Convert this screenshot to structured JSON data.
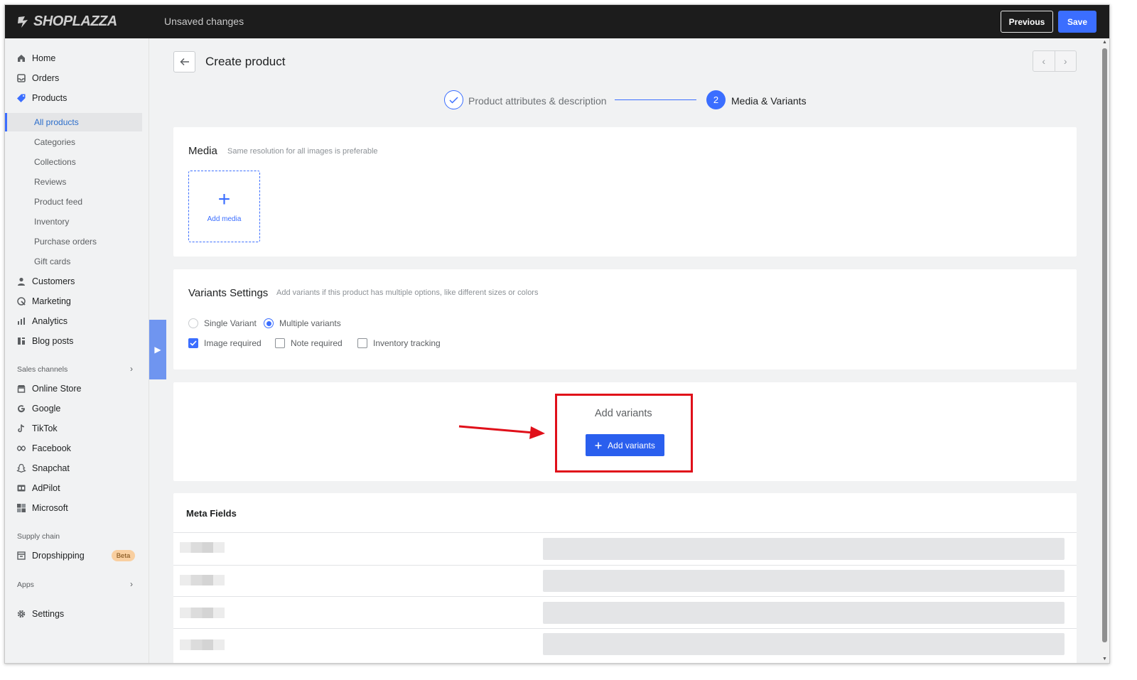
{
  "topbar": {
    "brand": "SHOPLAZZA",
    "status": "Unsaved changes",
    "previous_label": "Previous",
    "save_label": "Save"
  },
  "sidebar": {
    "items": [
      {
        "label": "Home",
        "icon": "home-icon"
      },
      {
        "label": "Orders",
        "icon": "orders-icon"
      },
      {
        "label": "Products",
        "icon": "tag-icon"
      }
    ],
    "product_sub": [
      {
        "label": "All products",
        "active": true
      },
      {
        "label": "Categories"
      },
      {
        "label": "Collections"
      },
      {
        "label": "Reviews"
      },
      {
        "label": "Product feed"
      },
      {
        "label": "Inventory"
      },
      {
        "label": "Purchase orders"
      },
      {
        "label": "Gift cards"
      }
    ],
    "items2": [
      {
        "label": "Customers",
        "icon": "person-icon"
      },
      {
        "label": "Marketing",
        "icon": "marketing-icon"
      },
      {
        "label": "Analytics",
        "icon": "analytics-icon"
      },
      {
        "label": "Blog posts",
        "icon": "blog-icon"
      }
    ],
    "sales_channels_label": "Sales channels",
    "channels": [
      {
        "label": "Online Store",
        "icon": "store-icon"
      },
      {
        "label": "Google",
        "icon": "google-icon"
      },
      {
        "label": "TikTok",
        "icon": "tiktok-icon"
      },
      {
        "label": "Facebook",
        "icon": "facebook-icon"
      },
      {
        "label": "Snapchat",
        "icon": "snapchat-icon"
      },
      {
        "label": "AdPilot",
        "icon": "adpilot-icon"
      },
      {
        "label": "Microsoft",
        "icon": "microsoft-icon"
      }
    ],
    "supply_chain_label": "Supply chain",
    "dropshipping_label": "Dropshipping",
    "beta_label": "Beta",
    "apps_label": "Apps",
    "settings_label": "Settings"
  },
  "page": {
    "title": "Create product",
    "steps": [
      {
        "label": "Product attributes & description",
        "state": "done"
      },
      {
        "number": "2",
        "label": "Media & Variants",
        "state": "current"
      }
    ]
  },
  "media": {
    "title": "Media",
    "hint": "Same resolution for all images is preferable",
    "add_label": "Add media"
  },
  "variants": {
    "title": "Variants Settings",
    "hint": "Add variants if this product has multiple options, like different sizes or colors",
    "single_label": "Single Variant",
    "multiple_label": "Multiple variants",
    "selected": "Multiple variants",
    "image_required_label": "Image required",
    "image_required": true,
    "note_required_label": "Note required",
    "note_required": false,
    "inventory_tracking_label": "Inventory tracking",
    "inventory_tracking": false
  },
  "add_variants": {
    "title": "Add variants",
    "button_label": "Add variants"
  },
  "meta_fields": {
    "title": "Meta Fields"
  },
  "colors": {
    "accent": "#3b6eff",
    "highlight": "#e0101a",
    "topbar": "#1c1c1c"
  }
}
